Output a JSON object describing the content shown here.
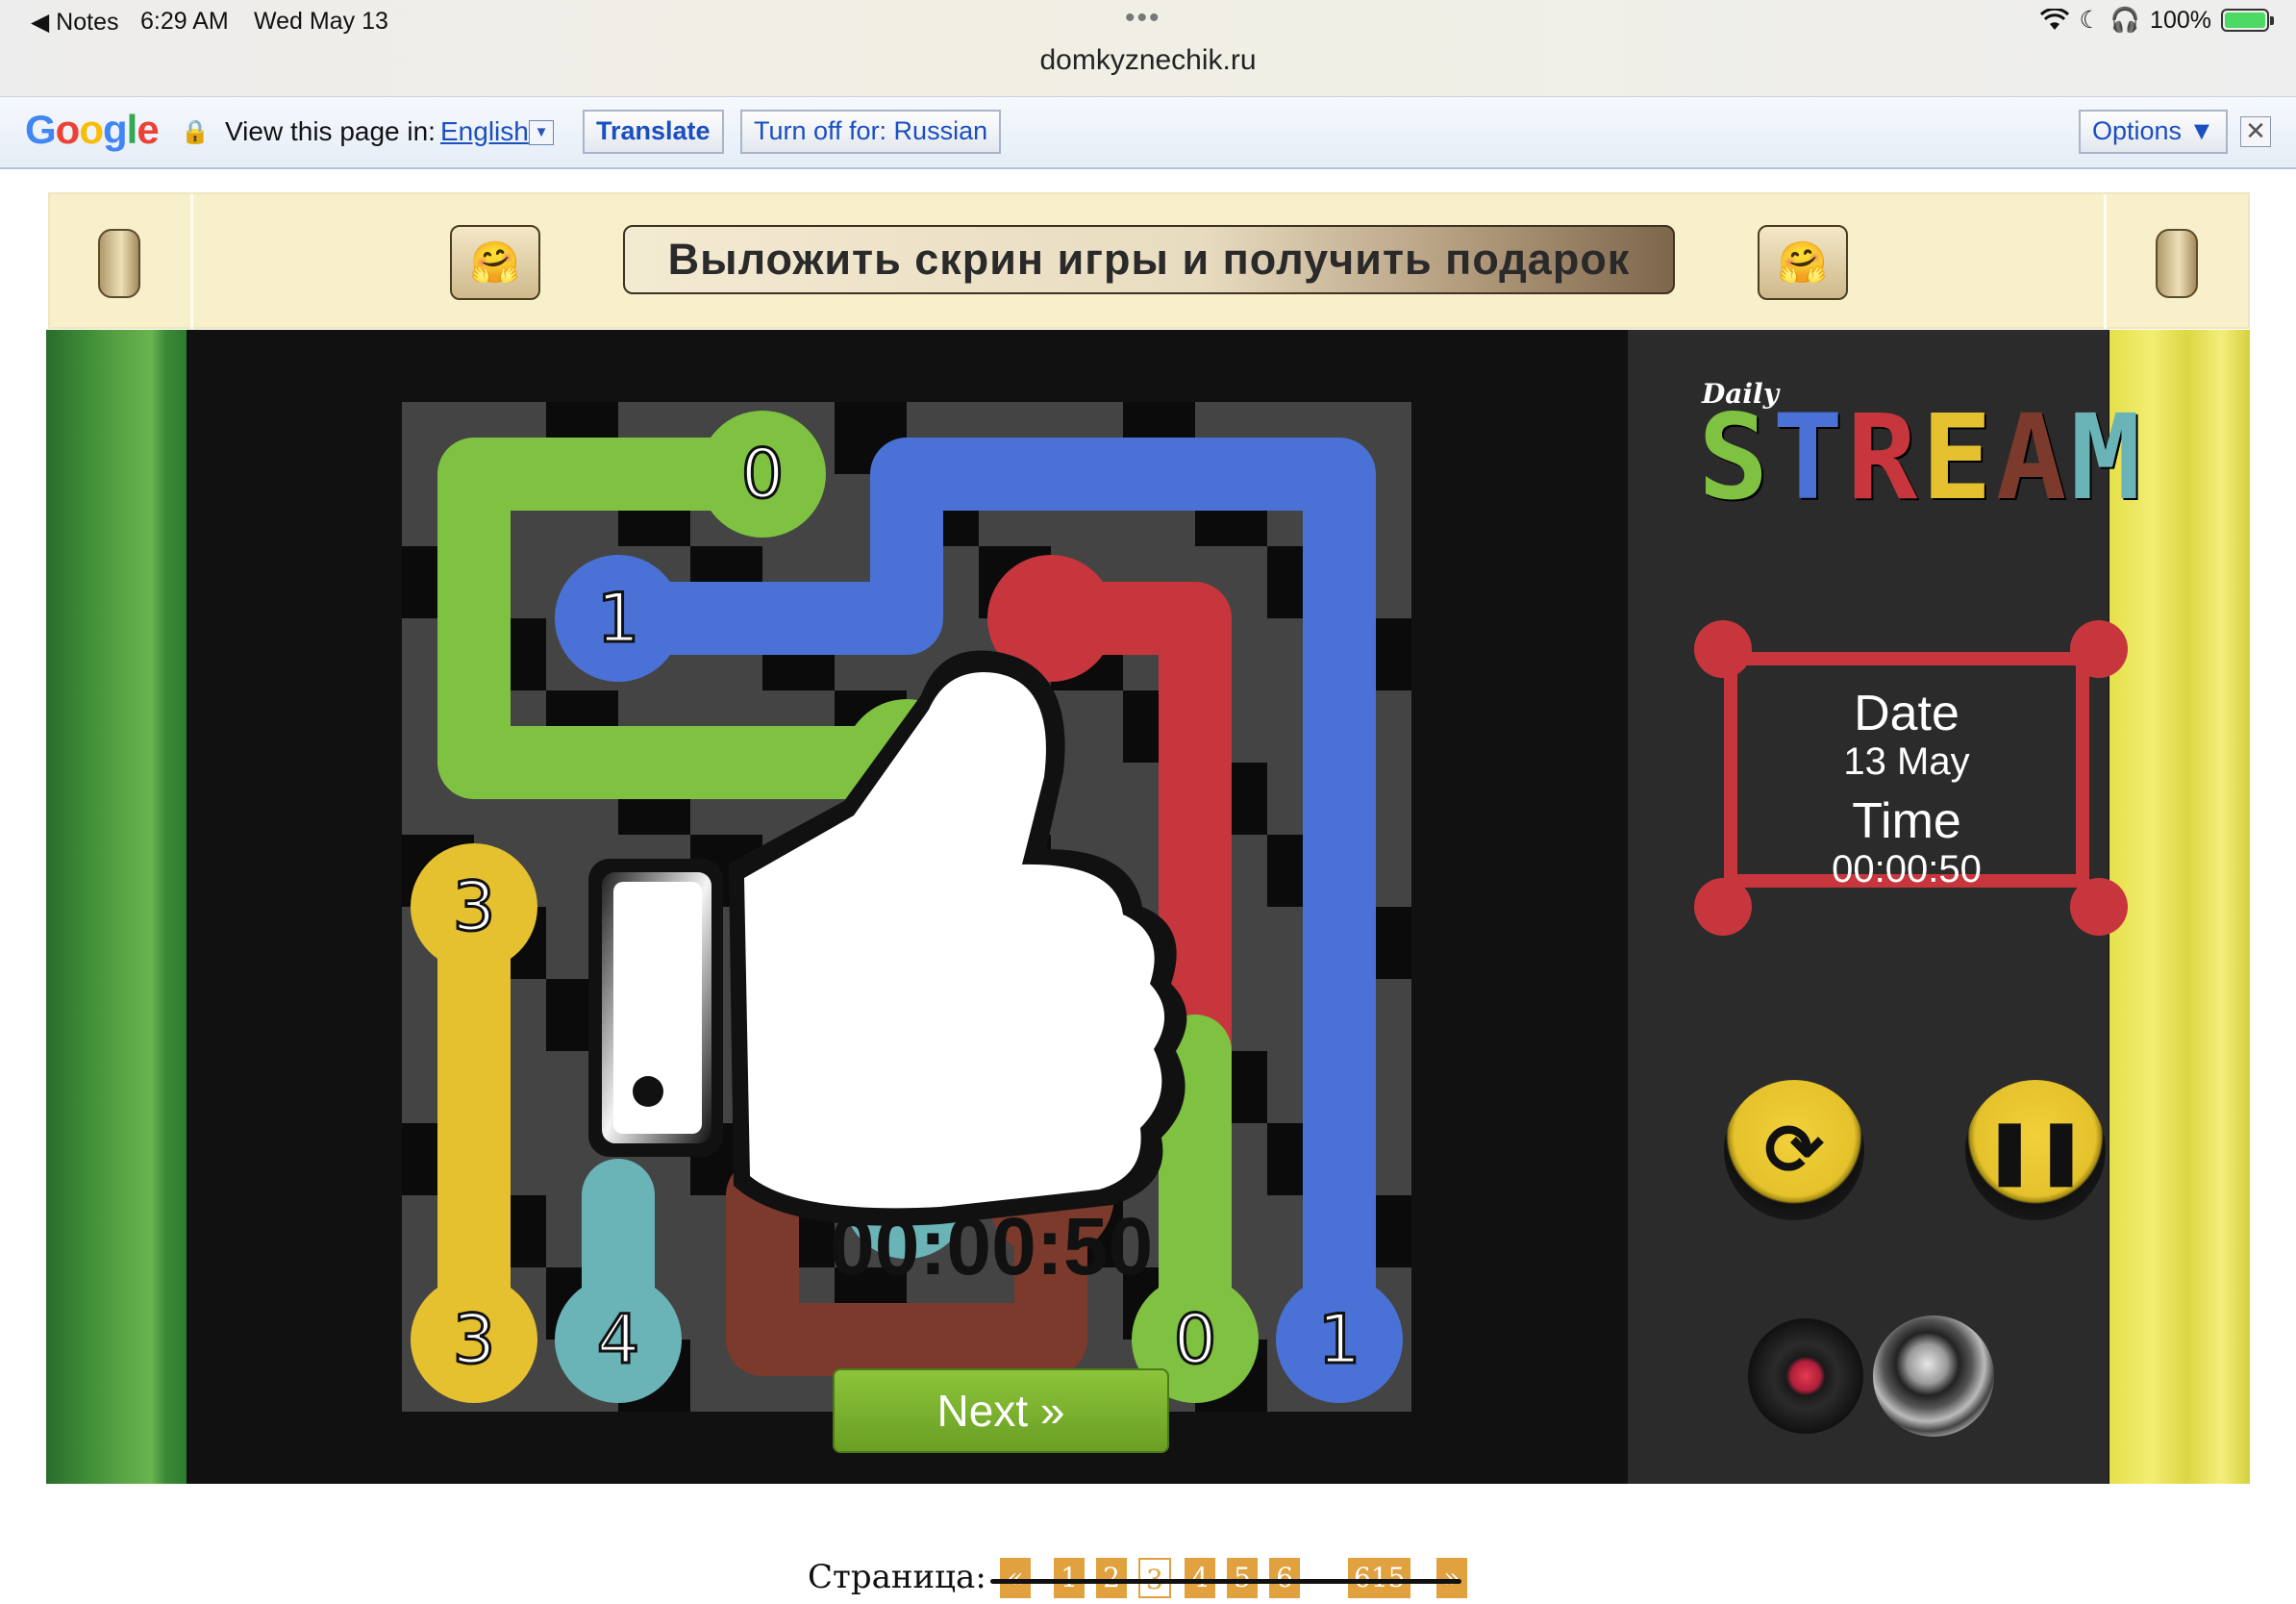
{
  "status_bar": {
    "back_app": "◀ Notes",
    "time": "6:29 AM",
    "date": "Wed May 13",
    "multitask": "•••",
    "url": "domkyznechik.ru",
    "battery": "100%"
  },
  "translate_bar": {
    "logo": "Google",
    "view_label": "View this page in:",
    "language": "English",
    "translate_button": "Translate",
    "turn_off_button": "Turn off for: Russian",
    "options_button": "Options ▼",
    "close": "✕"
  },
  "game_header": {
    "banner": "Выложить скрин игры и получить подарок",
    "emoji": "🤗"
  },
  "game": {
    "logo_small": "Daily",
    "logo_letters": [
      "S",
      "T",
      "R",
      "E",
      "A",
      "M"
    ],
    "logo_colors": [
      "#7fc242",
      "#4a72d6",
      "#c8363d",
      "#e6c12f",
      "#7b3a2c",
      "#6ab4b8"
    ],
    "date_label": "Date",
    "date_value": "13 May",
    "time_label": "Time",
    "time_value": "00:00:50",
    "overlay_time": "00:00:50",
    "next_button": "Next »",
    "restart_icon": "⟳",
    "pause_icon": "❚❚"
  },
  "board": {
    "grid": 7,
    "colors": {
      "green": "#7fc242",
      "blue": "#4a72d6",
      "red": "#c8363d",
      "yellow": "#e6c12f",
      "teal": "#6ab4b8",
      "brown": "#7b3a2c"
    },
    "endpoints": [
      {
        "label": "0",
        "color": "green"
      },
      {
        "label": "1",
        "color": "blue"
      },
      {
        "label": "3",
        "color": "yellow"
      },
      {
        "label": "3",
        "color": "yellow"
      },
      {
        "label": "4",
        "color": "teal"
      },
      {
        "label": "0",
        "color": "green"
      },
      {
        "label": "1",
        "color": "blue"
      }
    ]
  },
  "pagination": {
    "label": "Страница:",
    "prev": "«",
    "pages": [
      "1",
      "2",
      "3",
      "4",
      "5",
      "6"
    ],
    "current": "3",
    "ellipsis": "...",
    "last": "615",
    "next": "»"
  }
}
